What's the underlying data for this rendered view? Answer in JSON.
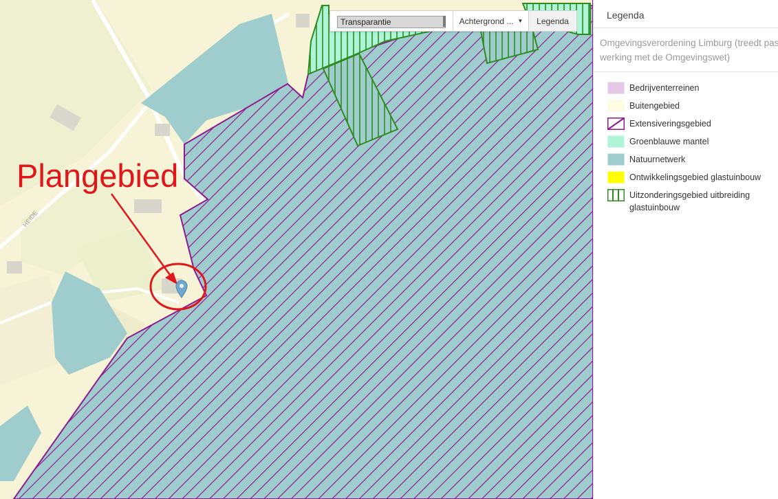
{
  "toolbar": {
    "transparency_label": "Transparantie",
    "transparency_value": 1.0,
    "background_label": "Achtergrond ...",
    "legend_button": "Legenda"
  },
  "map": {
    "annotation": "Plangebied",
    "road_label": "HEIDE",
    "marker_icon": "location-pin-icon"
  },
  "panel": {
    "header": "Legenda",
    "layer_title": "Omgevingsverordening Limburg (treedt pas in werking met de Omgevingswet)",
    "legend": [
      {
        "label": "Bedrijventerreinen",
        "fill": "#e4c8e6",
        "pattern": "solid"
      },
      {
        "label": "Buitengebied",
        "fill": "#fdfbe0",
        "pattern": "solid"
      },
      {
        "label": "Extensiveringsgebied",
        "fill": "#ffffff",
        "stroke": "#8e1a8e",
        "pattern": "diagonal"
      },
      {
        "label": "Groenblauwe mantel",
        "fill": "#aef5d8",
        "pattern": "solid"
      },
      {
        "label": "Natuurnetwerk",
        "fill": "#9fcccc",
        "pattern": "solid"
      },
      {
        "label": "Ontwikkelingsgebied glastuinbouw",
        "fill": "#ffff00",
        "pattern": "solid"
      },
      {
        "label": "Uitzonderingsgebied uitbreiding glastuinbouw",
        "fill": "#ffffff",
        "stroke": "#2e8b20",
        "pattern": "vertical"
      }
    ]
  },
  "colors": {
    "annotation_red": "#e0161b",
    "extensivering_stroke": "#8e1a8e",
    "natuurnetwerk": "#9fcccc",
    "groenblauw": "#aef5d8",
    "uitzondering_stroke": "#2e8b20"
  }
}
